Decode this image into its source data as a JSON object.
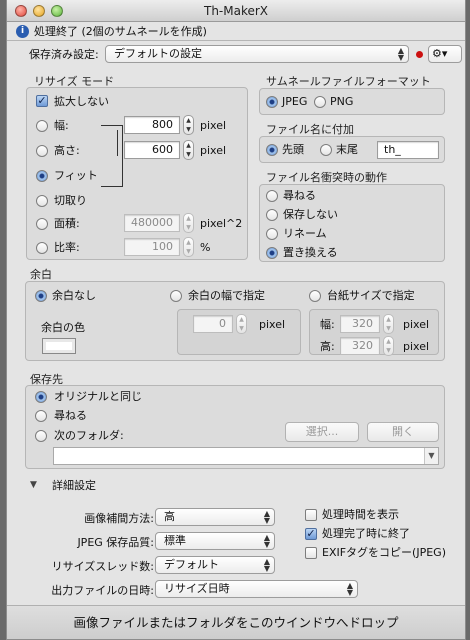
{
  "window": {
    "title": "Th-MakerX"
  },
  "status": {
    "text": "処理終了 (2個のサムネールを作成)"
  },
  "preset": {
    "label": "保存済み設定:",
    "value": "デフォルトの設定",
    "gear": "⚙▾"
  },
  "resize": {
    "title": "リサイズ モード",
    "no_enlarge": "拡大しない",
    "width_label": "幅:",
    "width_value": "800",
    "height_label": "高さ:",
    "height_value": "600",
    "fit": "フィット",
    "crop": "切取り",
    "area_label": "面積:",
    "area_value": "480000",
    "area_unit": "pixel^2",
    "ratio_label": "比率:",
    "ratio_value": "100",
    "ratio_unit": "%",
    "unit": "pixel"
  },
  "format": {
    "title": "サムネールファイルフォーマット",
    "jpeg": "JPEG",
    "png": "PNG"
  },
  "suffix": {
    "title": "ファイル名に付加",
    "prefix": "先頭",
    "suffix": "末尾",
    "value": "th_"
  },
  "conflict": {
    "title": "ファイル名衝突時の動作",
    "options": [
      "尋ねる",
      "保存しない",
      "リネーム",
      "置き換える"
    ]
  },
  "margin": {
    "title": "余白",
    "none": "余白なし",
    "by_width": "余白の幅で指定",
    "by_board": "台紙サイズで指定",
    "color_label": "余白の色",
    "width_value": "0",
    "unit": "pixel",
    "board_w_label": "幅:",
    "board_w_value": "320",
    "board_h_label": "高:",
    "board_h_value": "320"
  },
  "dest": {
    "title": "保存先",
    "same": "オリジナルと同じ",
    "ask": "尋ねる",
    "folder": "次のフォルダ:",
    "select_btn": "選択...",
    "open_btn": "開く"
  },
  "detail": {
    "title": "詳細設定",
    "interp_label": "画像補間方法:",
    "interp_value": "高",
    "jpeg_label": "JPEG 保存品質:",
    "jpeg_value": "標準",
    "threads_label": "リサイズスレッド数:",
    "threads_value": "デフォルト",
    "date_label": "出力ファイルの日時:",
    "date_value": "リサイズ日時",
    "show_time": "処理時間を表示",
    "quit_done": "処理完了時に終了",
    "exif": "EXIFタグをコピー(JPEG)"
  },
  "footer": {
    "text": "画像ファイルまたはフォルダをこのウインドウへドロップ"
  },
  "colors": {
    "accent": "#2a5db0",
    "record": "#cc1111",
    "margin_color": "#ffffff"
  }
}
